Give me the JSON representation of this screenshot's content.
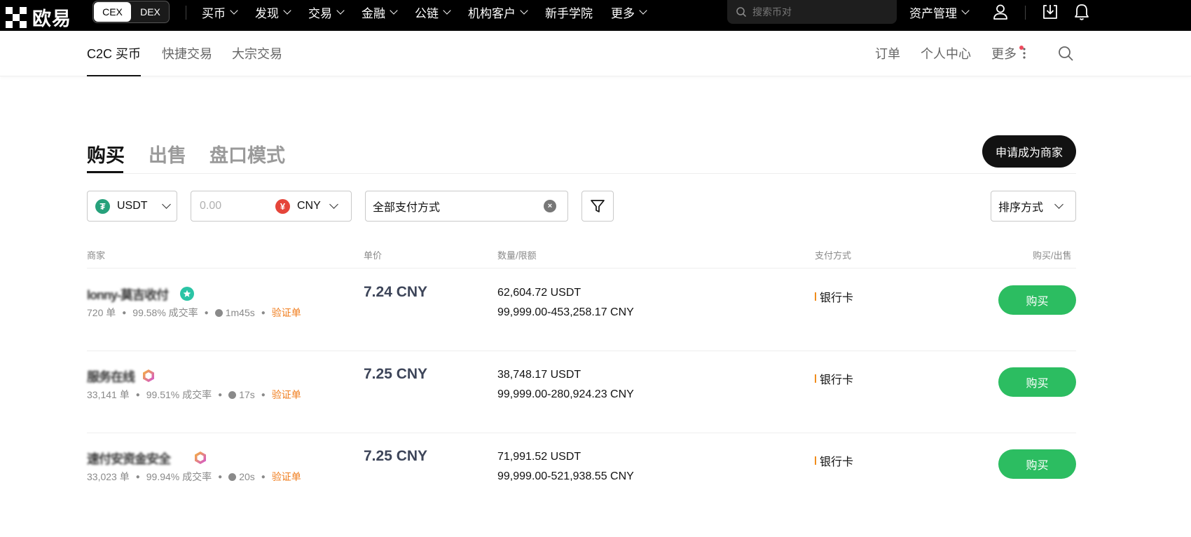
{
  "topnav": {
    "logo_text": "欧易",
    "cex_label": "CEX",
    "dex_label": "DEX",
    "menu": [
      "买币",
      "发现",
      "交易",
      "金融",
      "公链",
      "机构客户",
      "新手学院",
      "更多"
    ],
    "menu_has_chevron": [
      true,
      true,
      true,
      true,
      true,
      true,
      false,
      true
    ],
    "search_placeholder": "搜索币对",
    "asset_label": "资产管理",
    "icons": [
      "user-icon",
      "download-icon",
      "bell-icon"
    ]
  },
  "subnav": {
    "tabs": [
      "C2C 买币",
      "快捷交易",
      "大宗交易"
    ],
    "active_tab": "C2C 买币",
    "right": [
      "订单",
      "个人中心",
      "更多"
    ],
    "more_has_red_dot": true,
    "icons": [
      "more-vertical-icon",
      "search-icon"
    ]
  },
  "trade_tabs": [
    "购买",
    "出售",
    "盘口模式"
  ],
  "active_trade_tab": "购买",
  "merchant_button": "申请成为商家",
  "filters": {
    "crypto": "USDT",
    "amount_placeholder": "0.00",
    "fiat": "CNY",
    "payment": "全部支付方式",
    "sort": "排序方式"
  },
  "table": {
    "headers": [
      "商家",
      "单价",
      "数量/限额",
      "支付方式",
      "购买/出售"
    ],
    "rows": [
      {
        "merchant": "lonny-莫吉收付",
        "badge": "star-badge",
        "orders": "720 单",
        "rate": "99.58% 成交率",
        "time": "1m45s",
        "verified": "验证单",
        "price": "7.24 CNY",
        "qty": "62,604.72 USDT",
        "limit": "99,999.00-453,258.17 CNY",
        "payment": "银行卡",
        "action": "购买"
      },
      {
        "merchant": "服务在线",
        "badge": "hexagon-badge",
        "orders": "33,141 单",
        "rate": "99.51% 成交率",
        "time": "17s",
        "verified": "验证单",
        "price": "7.25 CNY",
        "qty": "38,748.17 USDT",
        "limit": "99,999.00-280,924.23 CNY",
        "payment": "银行卡",
        "action": "购买"
      },
      {
        "merchant": "速付安资金安全",
        "badge": "hexagon-badge",
        "orders": "33,023 单",
        "rate": "99.94% 成交率",
        "time": "20s",
        "verified": "验证单",
        "price": "7.25 CNY",
        "qty": "71,991.52 USDT",
        "limit": "99,999.00-521,938.55 CNY",
        "payment": "银行卡",
        "action": "购买"
      }
    ]
  },
  "colors": {
    "buy_green": "#2cbd61",
    "verified_orange": "#f07d1d",
    "usdt_green": "#26a17b",
    "cny_red": "#e5453a"
  }
}
